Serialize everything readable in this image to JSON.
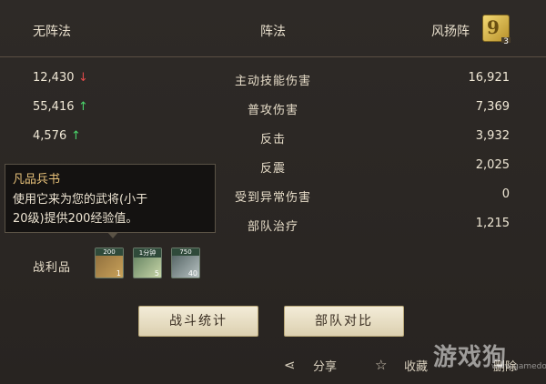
{
  "header": {
    "left": "无阵法",
    "center": "阵法",
    "right": "风扬阵",
    "formation_icon": {
      "name": "formation-icon",
      "glyph": "9",
      "level": "3"
    }
  },
  "stats": [
    {
      "left": "12,430",
      "left_trend": "down",
      "label": "主动技能伤害",
      "right": "16,921"
    },
    {
      "left": "55,416",
      "left_trend": "up",
      "label": "普攻伤害",
      "right": "7,369"
    },
    {
      "left": "4,576",
      "left_trend": "up",
      "label": "反击",
      "right": "3,932"
    },
    {
      "left": "",
      "left_trend": "up",
      "label": "反震",
      "right": "2,025"
    },
    {
      "left": "",
      "left_trend": "",
      "label": "受到异常伤害",
      "right": "0"
    },
    {
      "left": "",
      "left_trend": "",
      "label": "部队治疗",
      "right": "1,215"
    }
  ],
  "tooltip": {
    "title": "凡品兵书",
    "lines": [
      "使用它来为您的武将(小于",
      "20级)提供200经验值。"
    ]
  },
  "spoils": {
    "label": "战利品",
    "items": [
      {
        "icon": "scroll-icon",
        "quantity": "200",
        "count": "1"
      },
      {
        "icon": "time-scroll-icon",
        "quantity": "1分钟",
        "count": "5"
      },
      {
        "icon": "ore-icon",
        "quantity": "750",
        "count": "40"
      }
    ]
  },
  "buttons": {
    "battle_stats": "战斗统计",
    "troop_compare": "部队对比"
  },
  "footer": {
    "share": "分享",
    "favorite": "收藏",
    "delete": "删除"
  },
  "watermark": {
    "text": "游戏狗",
    "url": "www.gamedog.cn"
  },
  "colors": {
    "up": "#4ad36a",
    "down": "#e04a4a",
    "accent": "#e8c27a"
  }
}
